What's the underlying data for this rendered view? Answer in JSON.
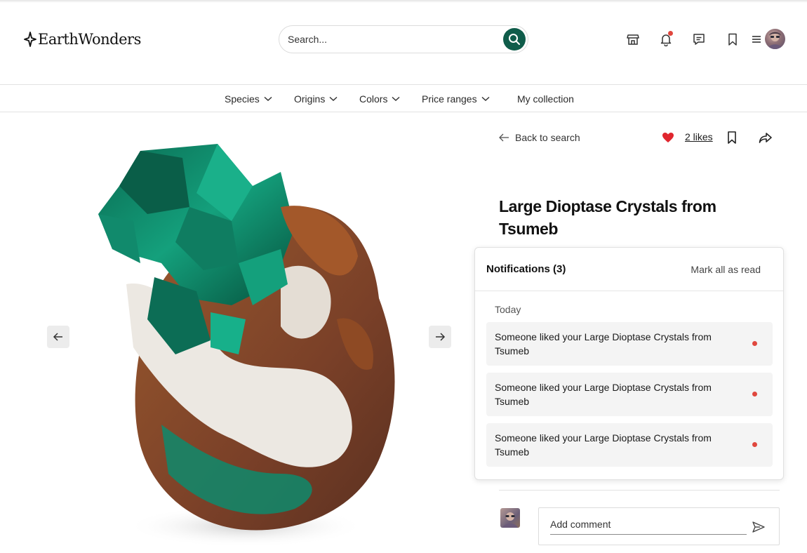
{
  "brand": {
    "name": "EarthWonders",
    "logo_icon": "sparkle-icon"
  },
  "search": {
    "placeholder": "Search...",
    "icon": "search-icon"
  },
  "header_icons": [
    "shop-icon",
    "bell-icon",
    "chat-icon",
    "bookmark-icon",
    "menu-icon"
  ],
  "nav": {
    "items": [
      {
        "label": "Species",
        "has_dropdown": true
      },
      {
        "label": "Origins",
        "has_dropdown": true
      },
      {
        "label": "Colors",
        "has_dropdown": true
      },
      {
        "label": "Price ranges",
        "has_dropdown": true
      },
      {
        "label": "My collection",
        "has_dropdown": false
      }
    ]
  },
  "detail": {
    "back_label": "Back to search",
    "likes_label": "2 likes",
    "title": "Large Dioptase Crystals from Tsumeb"
  },
  "notifications": {
    "title": "Notifications (3)",
    "mark_all_label": "Mark all as read",
    "group_label": "Today",
    "items": [
      {
        "text": "Someone liked your Large Dioptase Crystals from Tsumeb",
        "unread": true
      },
      {
        "text": "Someone liked your Large Dioptase Crystals from Tsumeb",
        "unread": true
      },
      {
        "text": "Someone liked your Large Dioptase Crystals from Tsumeb",
        "unread": true
      }
    ]
  },
  "comment": {
    "placeholder": "Add comment"
  },
  "colors": {
    "accent": "#0f5c4a",
    "heart": "#e0262e",
    "unread_dot": "#e0473e",
    "crystal_green": "#0e8a6c"
  }
}
